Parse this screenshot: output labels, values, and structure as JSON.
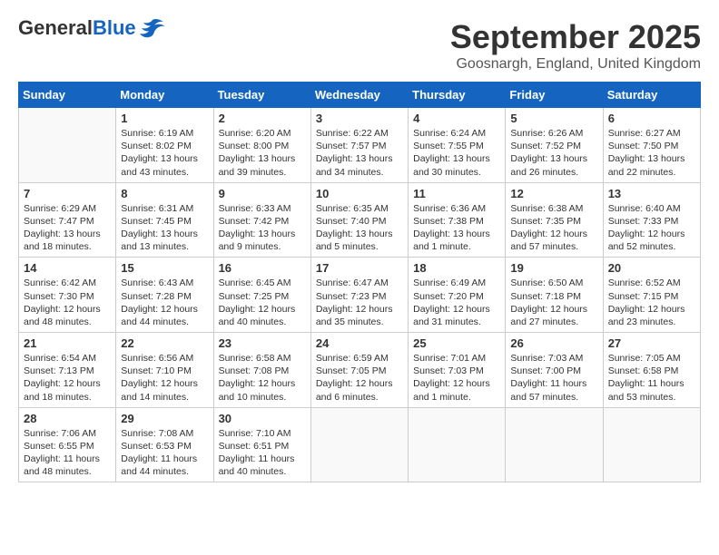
{
  "header": {
    "logo_general": "General",
    "logo_blue": "Blue",
    "month_title": "September 2025",
    "location": "Goosnargh, England, United Kingdom"
  },
  "calendar": {
    "days_of_week": [
      "Sunday",
      "Monday",
      "Tuesday",
      "Wednesday",
      "Thursday",
      "Friday",
      "Saturday"
    ],
    "weeks": [
      [
        {
          "day": "",
          "info": ""
        },
        {
          "day": "1",
          "info": "Sunrise: 6:19 AM\nSunset: 8:02 PM\nDaylight: 13 hours\nand 43 minutes."
        },
        {
          "day": "2",
          "info": "Sunrise: 6:20 AM\nSunset: 8:00 PM\nDaylight: 13 hours\nand 39 minutes."
        },
        {
          "day": "3",
          "info": "Sunrise: 6:22 AM\nSunset: 7:57 PM\nDaylight: 13 hours\nand 34 minutes."
        },
        {
          "day": "4",
          "info": "Sunrise: 6:24 AM\nSunset: 7:55 PM\nDaylight: 13 hours\nand 30 minutes."
        },
        {
          "day": "5",
          "info": "Sunrise: 6:26 AM\nSunset: 7:52 PM\nDaylight: 13 hours\nand 26 minutes."
        },
        {
          "day": "6",
          "info": "Sunrise: 6:27 AM\nSunset: 7:50 PM\nDaylight: 13 hours\nand 22 minutes."
        }
      ],
      [
        {
          "day": "7",
          "info": "Sunrise: 6:29 AM\nSunset: 7:47 PM\nDaylight: 13 hours\nand 18 minutes."
        },
        {
          "day": "8",
          "info": "Sunrise: 6:31 AM\nSunset: 7:45 PM\nDaylight: 13 hours\nand 13 minutes."
        },
        {
          "day": "9",
          "info": "Sunrise: 6:33 AM\nSunset: 7:42 PM\nDaylight: 13 hours\nand 9 minutes."
        },
        {
          "day": "10",
          "info": "Sunrise: 6:35 AM\nSunset: 7:40 PM\nDaylight: 13 hours\nand 5 minutes."
        },
        {
          "day": "11",
          "info": "Sunrise: 6:36 AM\nSunset: 7:38 PM\nDaylight: 13 hours\nand 1 minute."
        },
        {
          "day": "12",
          "info": "Sunrise: 6:38 AM\nSunset: 7:35 PM\nDaylight: 12 hours\nand 57 minutes."
        },
        {
          "day": "13",
          "info": "Sunrise: 6:40 AM\nSunset: 7:33 PM\nDaylight: 12 hours\nand 52 minutes."
        }
      ],
      [
        {
          "day": "14",
          "info": "Sunrise: 6:42 AM\nSunset: 7:30 PM\nDaylight: 12 hours\nand 48 minutes."
        },
        {
          "day": "15",
          "info": "Sunrise: 6:43 AM\nSunset: 7:28 PM\nDaylight: 12 hours\nand 44 minutes."
        },
        {
          "day": "16",
          "info": "Sunrise: 6:45 AM\nSunset: 7:25 PM\nDaylight: 12 hours\nand 40 minutes."
        },
        {
          "day": "17",
          "info": "Sunrise: 6:47 AM\nSunset: 7:23 PM\nDaylight: 12 hours\nand 35 minutes."
        },
        {
          "day": "18",
          "info": "Sunrise: 6:49 AM\nSunset: 7:20 PM\nDaylight: 12 hours\nand 31 minutes."
        },
        {
          "day": "19",
          "info": "Sunrise: 6:50 AM\nSunset: 7:18 PM\nDaylight: 12 hours\nand 27 minutes."
        },
        {
          "day": "20",
          "info": "Sunrise: 6:52 AM\nSunset: 7:15 PM\nDaylight: 12 hours\nand 23 minutes."
        }
      ],
      [
        {
          "day": "21",
          "info": "Sunrise: 6:54 AM\nSunset: 7:13 PM\nDaylight: 12 hours\nand 18 minutes."
        },
        {
          "day": "22",
          "info": "Sunrise: 6:56 AM\nSunset: 7:10 PM\nDaylight: 12 hours\nand 14 minutes."
        },
        {
          "day": "23",
          "info": "Sunrise: 6:58 AM\nSunset: 7:08 PM\nDaylight: 12 hours\nand 10 minutes."
        },
        {
          "day": "24",
          "info": "Sunrise: 6:59 AM\nSunset: 7:05 PM\nDaylight: 12 hours\nand 6 minutes."
        },
        {
          "day": "25",
          "info": "Sunrise: 7:01 AM\nSunset: 7:03 PM\nDaylight: 12 hours\nand 1 minute."
        },
        {
          "day": "26",
          "info": "Sunrise: 7:03 AM\nSunset: 7:00 PM\nDaylight: 11 hours\nand 57 minutes."
        },
        {
          "day": "27",
          "info": "Sunrise: 7:05 AM\nSunset: 6:58 PM\nDaylight: 11 hours\nand 53 minutes."
        }
      ],
      [
        {
          "day": "28",
          "info": "Sunrise: 7:06 AM\nSunset: 6:55 PM\nDaylight: 11 hours\nand 48 minutes."
        },
        {
          "day": "29",
          "info": "Sunrise: 7:08 AM\nSunset: 6:53 PM\nDaylight: 11 hours\nand 44 minutes."
        },
        {
          "day": "30",
          "info": "Sunrise: 7:10 AM\nSunset: 6:51 PM\nDaylight: 11 hours\nand 40 minutes."
        },
        {
          "day": "",
          "info": ""
        },
        {
          "day": "",
          "info": ""
        },
        {
          "day": "",
          "info": ""
        },
        {
          "day": "",
          "info": ""
        }
      ]
    ]
  }
}
